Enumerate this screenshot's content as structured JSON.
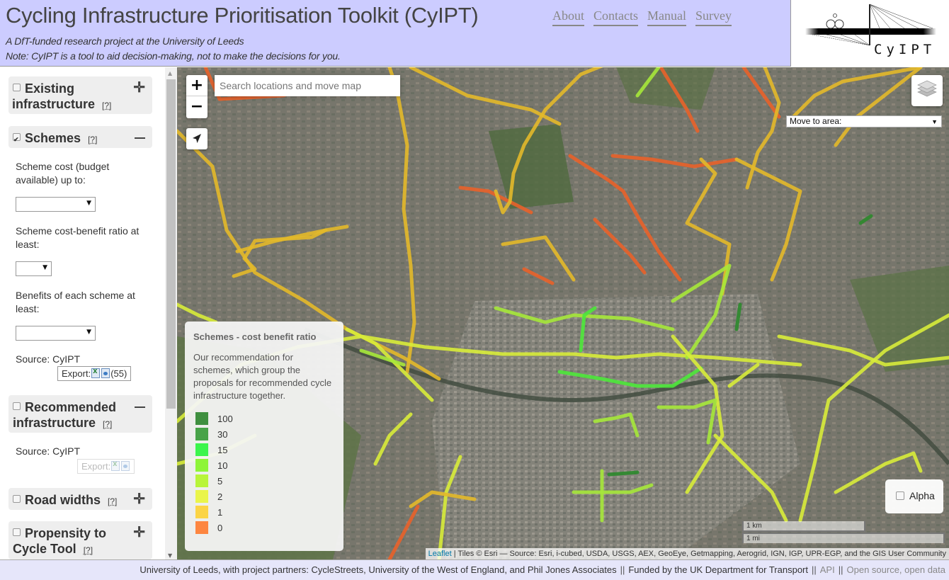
{
  "header": {
    "title": "Cycling Infrastructure Prioritisation Toolkit (CyIPT)",
    "tagline": "A DfT-funded research project at the University of Leeds",
    "note": "Note: CyIPT is a tool to aid decision-making, not to make the decisions for you.",
    "nav": [
      "About",
      "Contacts",
      "Manual",
      "Survey"
    ],
    "logo_text": "CyIPT"
  },
  "sidebar": {
    "layers": [
      {
        "title_line1": "Existing",
        "title_line2": "infrastructure",
        "help": "[?]",
        "checked": false,
        "expanded": false
      },
      {
        "title_line1": "Schemes",
        "help": "[?]",
        "checked": true,
        "expanded": true
      },
      {
        "title_line1": "Recommended",
        "title_line2": "infrastructure",
        "help": "[?]",
        "checked": false,
        "expanded": true
      },
      {
        "title_line1": "Road widths",
        "help": "[?]",
        "checked": false,
        "expanded": false
      },
      {
        "title_line1": "Propensity to",
        "title_line2": "Cycle Tool",
        "help": "[?]",
        "checked": false,
        "expanded": false
      }
    ],
    "schemes": {
      "cost_label": "Scheme cost (budget available) up to:",
      "cost_value": "",
      "ratio_label": "Scheme cost-benefit ratio at least:",
      "ratio_value": "",
      "benefits_label": "Benefits of each scheme at least:",
      "benefits_value": "",
      "source": "Source: CyIPT",
      "export_label": "Export:",
      "export_count": "(55)"
    },
    "recommended": {
      "source": "Source: CyIPT",
      "export_label": "Export:"
    }
  },
  "map": {
    "zoom_in": "+",
    "zoom_out": "−",
    "search_placeholder": "Search locations and move map",
    "move_to_area": "Move to area:",
    "legend": {
      "title": "Schemes - cost benefit ratio",
      "description": "Our recommendation for schemes, which group the proposals for recommended cycle infrastructure together.",
      "items": [
        {
          "label": "100",
          "color": "#3f8f3f"
        },
        {
          "label": "30",
          "color": "#48a348"
        },
        {
          "label": "15",
          "color": "#3cf54c"
        },
        {
          "label": "10",
          "color": "#8ef538"
        },
        {
          "label": "5",
          "color": "#b8f53a"
        },
        {
          "label": "2",
          "color": "#eaf54a"
        },
        {
          "label": "1",
          "color": "#fbd445"
        },
        {
          "label": "0",
          "color": "#fd8640"
        }
      ]
    },
    "alpha_label": "Alpha",
    "alpha_checked": false,
    "scale_km": "1 km",
    "scale_mi": "1 mi",
    "attribution_link": "Leaflet",
    "attribution_text": " | Tiles © Esri — Source: Esri, i-cubed, USDA, USGS, AEX, GeoEye, Getmapping, Aerogrid, IGN, IGP, UPR-EGP, and the GIS User Community"
  },
  "footer": {
    "partners": "University of Leeds, with project partners: CycleStreets, University of the West of England, and Phil Jones Associates",
    "sep": "||",
    "funding": "Funded by the UK Department for Transport",
    "api": "API",
    "open": "Open source, open data"
  }
}
